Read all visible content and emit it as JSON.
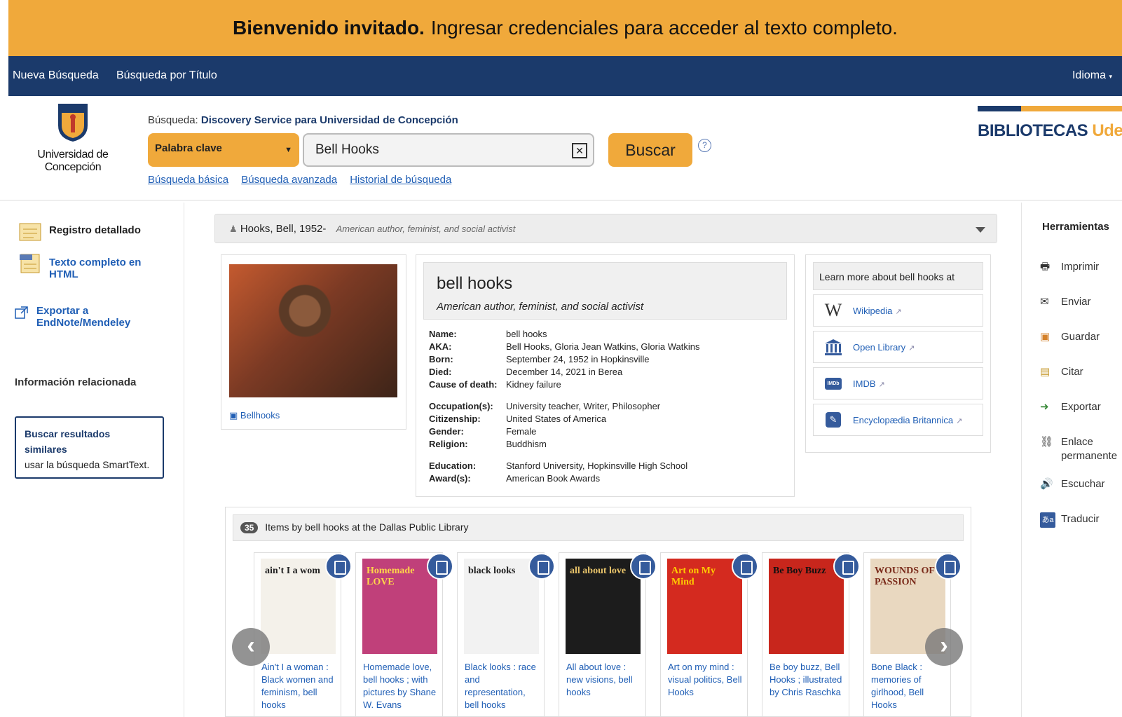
{
  "banner": {
    "bold": "Bienvenido invitado.",
    "text": "Ingresar credenciales para acceder al texto completo."
  },
  "topnav": {
    "nueva": "Nueva Búsqueda",
    "titulo": "Búsqueda por Título",
    "idioma": "Idioma"
  },
  "header": {
    "udec_name": "Universidad de Concepción",
    "search_label": "Búsqueda:",
    "search_service": "Discovery Service para Universidad de Concepción",
    "field_select": "Palabra clave",
    "query": "Bell Hooks",
    "buscar": "Buscar",
    "help": "?",
    "links": [
      "Búsqueda básica",
      "Búsqueda avanzada",
      "Historial de búsqueda"
    ],
    "bib_logo_a": "BIBLIOTECAS ",
    "bib_logo_b": "UdeC"
  },
  "left": {
    "registro": "Registro detallado",
    "texto_completo": "Texto completo en HTML",
    "exportar": "Exportar a EndNote/Mendeley",
    "rel_title": "Información relacionada",
    "similar_title": "Buscar resultados similares",
    "similar_desc": "usar la búsqueda SmartText."
  },
  "person": {
    "head_name": "Hooks, Bell, 1952-",
    "head_desc": "American author, feminist, and social activist",
    "photo_caption": "Bellhooks",
    "name": "bell hooks",
    "subtitle": "American author, feminist, and social activist",
    "facts": [
      {
        "k": "Name:",
        "v": "bell hooks"
      },
      {
        "k": "AKA:",
        "v": "Bell Hooks, Gloria Jean Watkins, Gloria Watkins"
      },
      {
        "k": "Born:",
        "v": "September 24, 1952 in Hopkinsville"
      },
      {
        "k": "Died:",
        "v": "December 14, 2021 in Berea"
      },
      {
        "k": "Cause of death:",
        "v": "Kidney failure"
      },
      {
        "k": "Occupation(s):",
        "v": "University teacher, Writer, Philosopher"
      },
      {
        "k": "Citizenship:",
        "v": "United States of America"
      },
      {
        "k": "Gender:",
        "v": "Female"
      },
      {
        "k": "Religion:",
        "v": "Buddhism"
      },
      {
        "k": "Education:",
        "v": "Stanford University, Hopkinsville High School"
      },
      {
        "k": "Award(s):",
        "v": "American Book Awards"
      }
    ]
  },
  "learn": {
    "title": "Learn more about bell hooks at",
    "links": [
      "Wikipedia",
      "Open Library",
      "IMDB",
      "Encyclopædia Britannica"
    ]
  },
  "items": {
    "count": "35",
    "title": "Items by bell hooks at the Dallas Public Library",
    "books": [
      {
        "title": "Ain't I a woman : Black women and feminism, bell hooks",
        "cover": "ain't I a wom",
        "bg": "#f4f1ea",
        "fg": "#222"
      },
      {
        "title": "Homemade love, bell hooks ; with pictures by Shane W. Evans",
        "cover": "Homemade LOVE",
        "bg": "#c0407a",
        "fg": "#ffd54a"
      },
      {
        "title": "Black looks : race and representation, bell hooks",
        "cover": "black looks",
        "bg": "#f2f2f2",
        "fg": "#222"
      },
      {
        "title": "All about love : new visions, bell hooks",
        "cover": "all about love",
        "bg": "#1c1c1c",
        "fg": "#e9c46a"
      },
      {
        "title": "Art on my mind : visual politics, Bell Hooks",
        "cover": "Art on My Mind",
        "bg": "#d42a1f",
        "fg": "#ffcc00"
      },
      {
        "title": "Be boy buzz, Bell Hooks ; illustrated by Chris Raschka",
        "cover": "Be Boy Buzz",
        "bg": "#c8261c",
        "fg": "#111"
      },
      {
        "title": "Bone Black : memories of girlhood, Bell Hooks",
        "cover": "WOUNDS OF PASSION",
        "bg": "#e9d8c0",
        "fg": "#7a2a1a"
      }
    ]
  },
  "tools": {
    "title": "Herramientas",
    "list": [
      "Imprimir",
      "Enviar",
      "Guardar",
      "Citar",
      "Exportar",
      "Enlace permanente",
      "Escuchar",
      "Traducir"
    ]
  }
}
